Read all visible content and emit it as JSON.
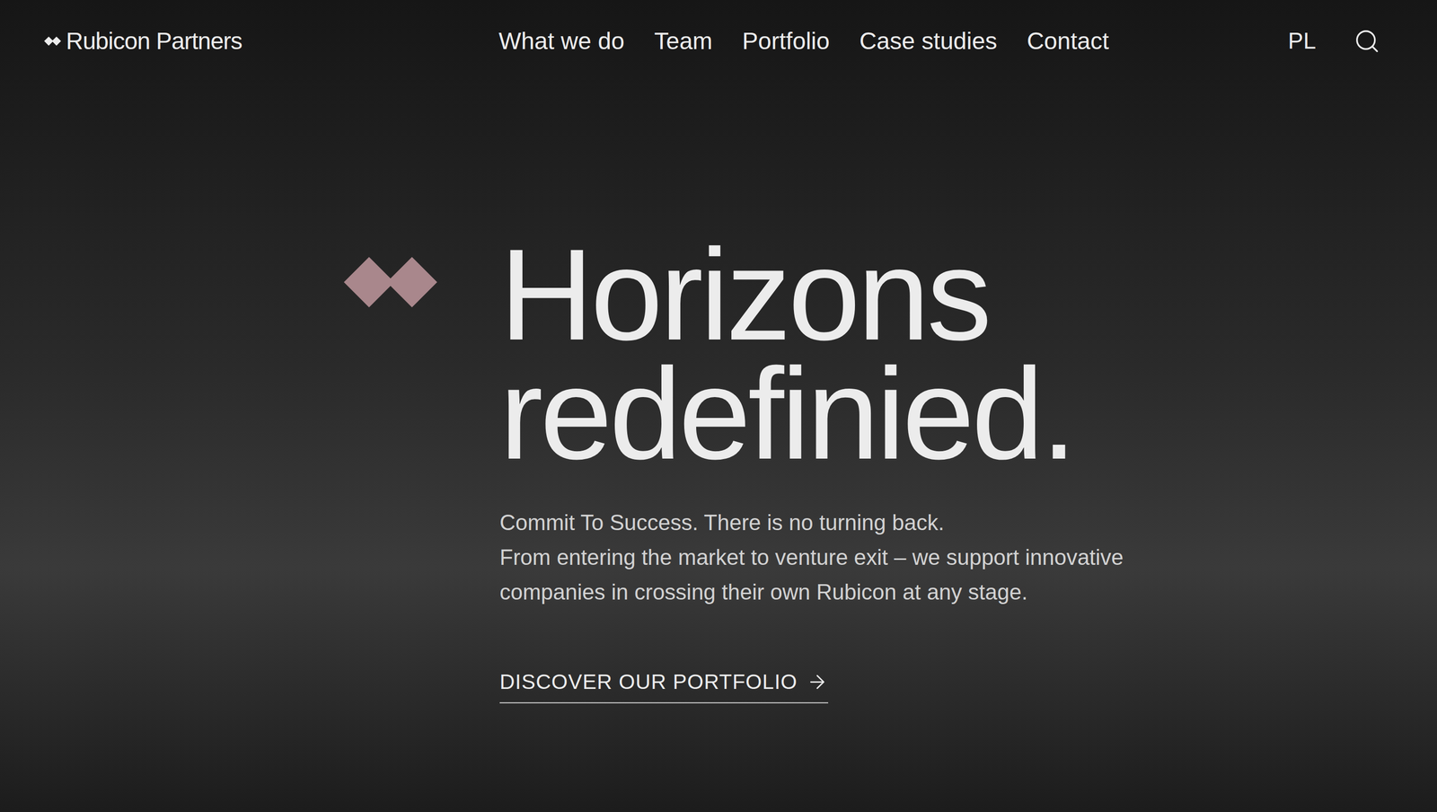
{
  "header": {
    "logo": "Rubicon Partners",
    "nav": [
      "What we do",
      "Team",
      "Portfolio",
      "Case studies",
      "Contact"
    ],
    "language": "PL"
  },
  "hero": {
    "title_lines": [
      "Horizons",
      "redefinied."
    ],
    "subtitle_lines": [
      "Commit To Success. There is no turning back.",
      "From entering the market to venture exit – we support innovative",
      "companies in crossing their own Rubicon at any stage."
    ],
    "cta": "DISCOVER OUR PORTFOLIO"
  }
}
